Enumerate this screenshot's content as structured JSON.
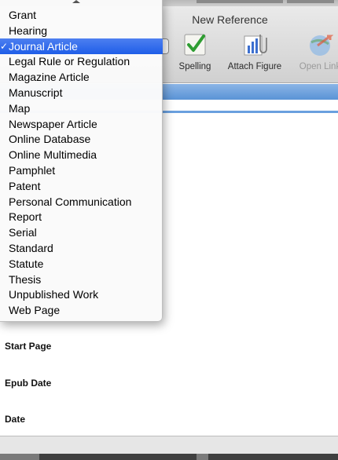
{
  "window": {
    "title": "New Reference"
  },
  "toolbar": {
    "spelling_label": "Spelling",
    "attach_figure_label": "Attach Figure",
    "open_link_label": "Open Link"
  },
  "fields": {
    "start_page": "Start Page",
    "epub_date": "Epub Date",
    "date": "Date"
  },
  "menu": {
    "selected_index": 2,
    "checkmark": "✓",
    "items": [
      "Grant",
      "Hearing",
      "Journal Article",
      "Legal Rule or Regulation",
      "Magazine Article",
      "Manuscript",
      "Map",
      "Newspaper Article",
      "Online Database",
      "Online Multimedia",
      "Pamphlet",
      "Patent",
      "Personal Communication",
      "Report",
      "Serial",
      "Standard",
      "Statute",
      "Thesis",
      "Unpublished Work",
      "Web Page"
    ]
  },
  "colors": {
    "selection": "#2f6bea",
    "tab_bar": "#6aa0df"
  }
}
